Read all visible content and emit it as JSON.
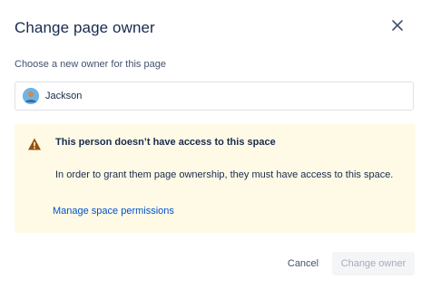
{
  "dialog": {
    "title": "Change page owner",
    "close_icon": "close-icon"
  },
  "owner_field": {
    "label": "Choose a new owner for this page",
    "value": "Jackson",
    "avatar_icon": "user-avatar"
  },
  "warning": {
    "icon": "warning-icon",
    "title": "This person doesn’t have access to this space",
    "body": "In order to grant them page ownership, they must have access to this space.",
    "link": "Manage space permissions",
    "background": "#fffae6",
    "icon_color": "#974f0c"
  },
  "footer": {
    "cancel_label": "Cancel",
    "submit_label": "Change owner",
    "submit_disabled": true
  },
  "colors": {
    "link": "#0052cc",
    "text": "#172b4d",
    "disabled_text": "#a5adba",
    "disabled_bg": "#f4f5f7"
  }
}
